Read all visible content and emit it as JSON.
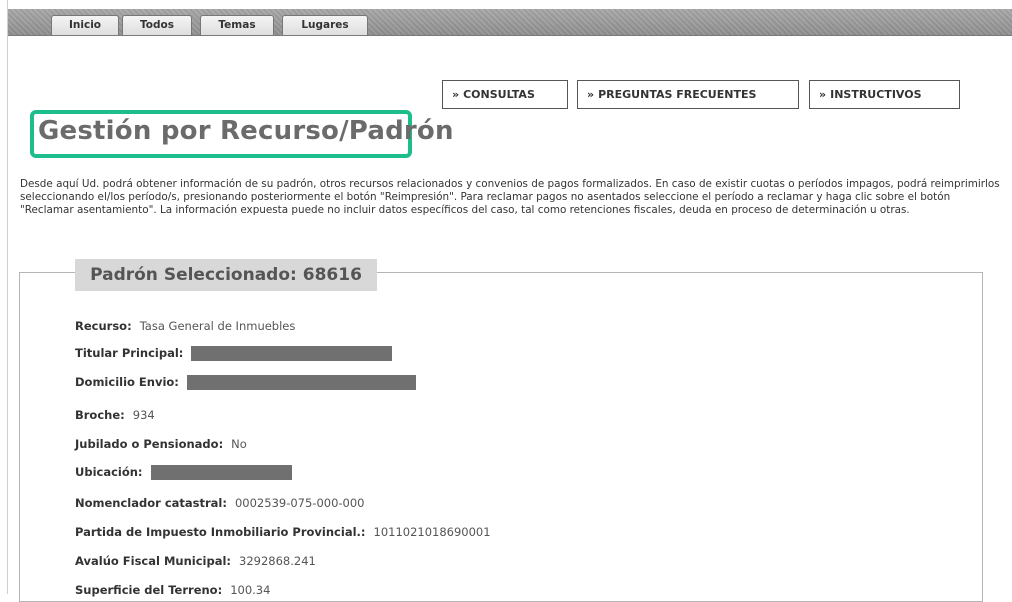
{
  "tabs": [
    "Inicio",
    "Todos",
    "Temas",
    "Lugares"
  ],
  "nav_buttons": [
    {
      "icon": "double-chevron-right-icon",
      "symbol": "»",
      "label": "CONSULTAS"
    },
    {
      "icon": "double-chevron-right-icon",
      "symbol": "»",
      "label": "PREGUNTAS FRECUENTES"
    },
    {
      "icon": "double-chevron-right-icon",
      "symbol": "»",
      "label": "INSTRUCTIVOS"
    }
  ],
  "page_title": "Gestión por Recurso/Padrón",
  "description": "Desde aquí Ud. podrá obtener información de su padrón, otros recursos relacionados y convenios de pagos formalizados. En caso de existir cuotas o períodos impagos, podrá reimprimirlos seleccionando el/los período/s, presionando posteriormente el botón \"Reimpresión\". Para reclamar pagos no asentados seleccione el período a reclamar y haga clic sobre el botón \"Reclamar asentamiento\". La información expuesta puede no incluir datos específicos del caso, tal como retenciones fiscales, deuda en proceso de determinación u otras.",
  "padron": {
    "heading": "Padrón Seleccionado: 68616",
    "fields": [
      {
        "label": "Recurso:",
        "value": "Tasa General de Inmuebles"
      },
      {
        "label": "Titular Principal:",
        "value": "",
        "redacted": true
      },
      {
        "label": "Domicilio Envio:",
        "value": "",
        "redacted": true
      },
      {
        "label": "Broche:",
        "value": "934"
      },
      {
        "label": "Jubilado o Pensionado:",
        "value": "No"
      },
      {
        "label": "Ubicación:",
        "value": "",
        "redacted": true
      },
      {
        "label": "Nomenclador catastral:",
        "value": "0002539-075-000-000"
      },
      {
        "label": "Partida de Impuesto Inmobiliario Provincial.:",
        "value": "1011021018690001"
      },
      {
        "label": "Avalúo Fiscal Municipal:",
        "value": "3292868.241"
      },
      {
        "label": "Superficie del Terreno:",
        "value": "100.34"
      }
    ]
  },
  "colors": {
    "highlight": "#1ebe8c",
    "topbar": "#9a9a9a",
    "legend_bg": "#d8d8d8",
    "redaction": "#707070"
  }
}
